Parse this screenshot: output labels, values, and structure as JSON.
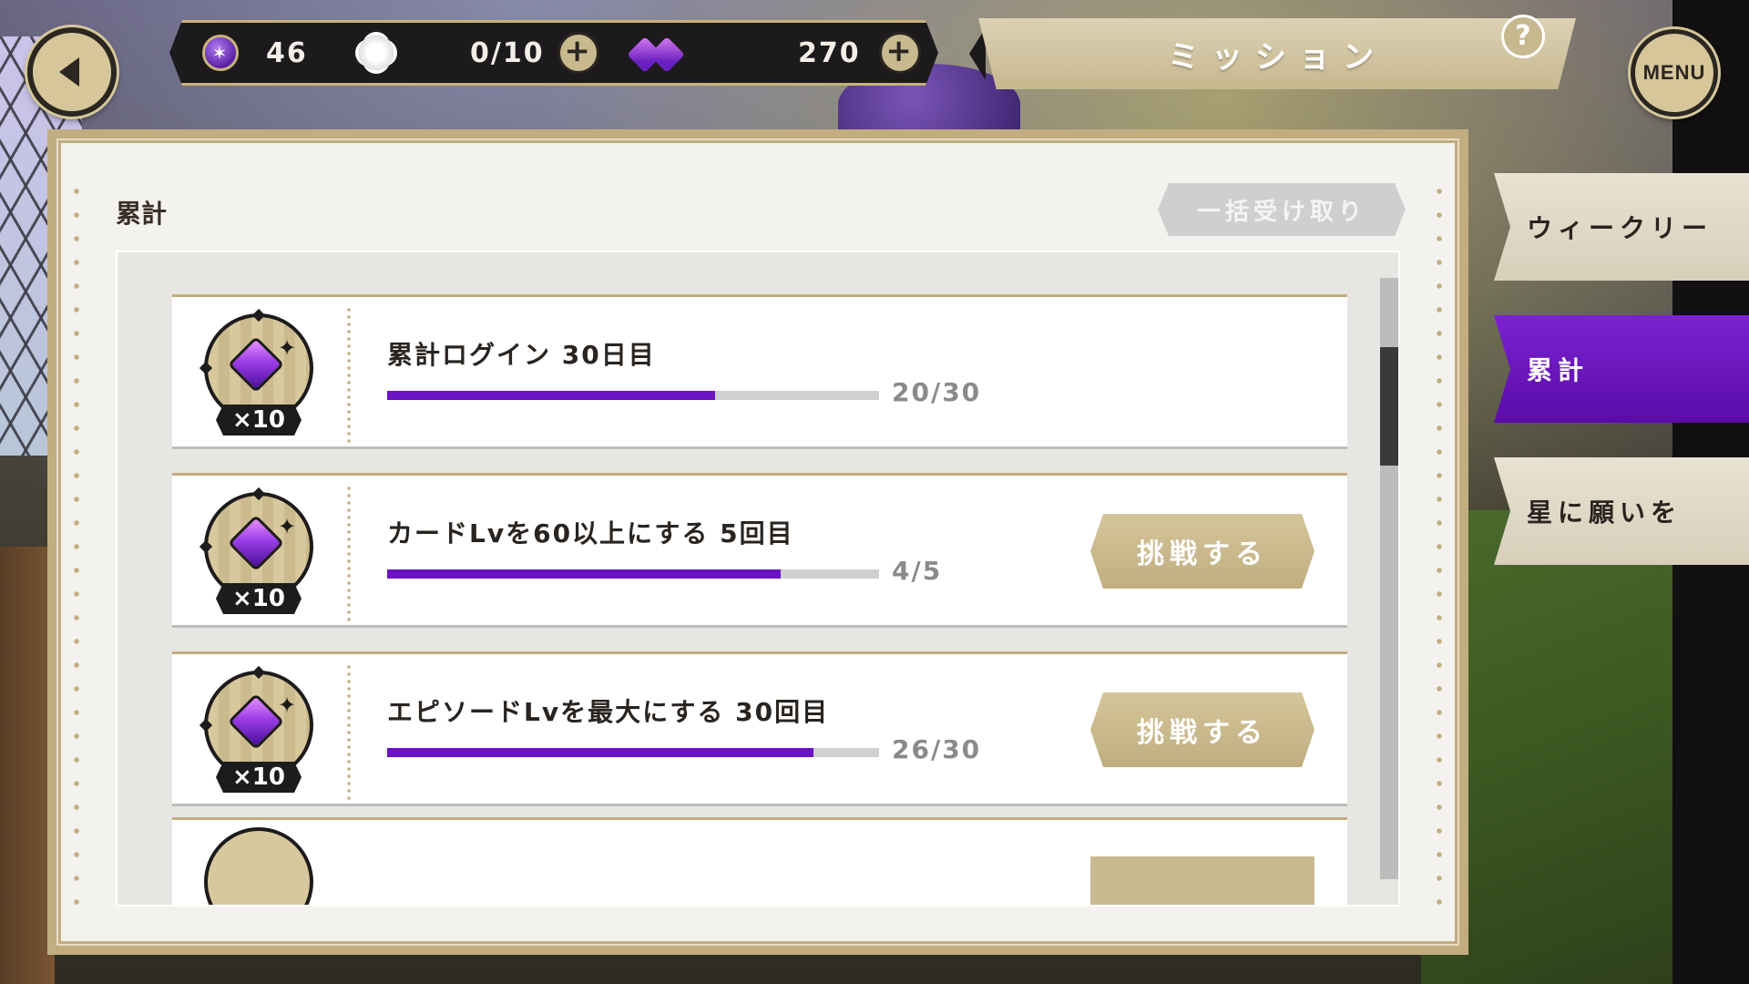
{
  "topbar": {
    "orb_count": "46",
    "flower_count": "0/10",
    "gem_count": "270",
    "title": "ミッション",
    "help_label": "?",
    "menu_label": "MENU",
    "orb_symbol": "✶"
  },
  "panel": {
    "section_title": "累計",
    "receive_all_label": "一括受け取り"
  },
  "missions": [
    {
      "text": "累計ログイン 30日目",
      "progress_label": "20/30",
      "progress": 0.667,
      "reward_count": "×10",
      "button": ""
    },
    {
      "text": "カードLvを60以上にする 5回目",
      "progress_label": "4/5",
      "progress": 0.8,
      "reward_count": "×10",
      "button": "挑戦する"
    },
    {
      "text": "エピソードLvを最大にする 30回目",
      "progress_label": "26/30",
      "progress": 0.867,
      "reward_count": "×10",
      "button": "挑戦する"
    }
  ],
  "tabs": [
    {
      "label": "ウィークリー",
      "active": false
    },
    {
      "label": "累計",
      "active": true
    },
    {
      "label": "星に願いを",
      "active": false
    }
  ],
  "colors": {
    "accent_purple": "#6a12c4",
    "gold": "#c2ad80"
  },
  "icons": [
    "back-arrow-icon",
    "orb-icon",
    "flower-icon",
    "gem-icon",
    "plus-icon",
    "help-icon",
    "sparkle-icon"
  ]
}
